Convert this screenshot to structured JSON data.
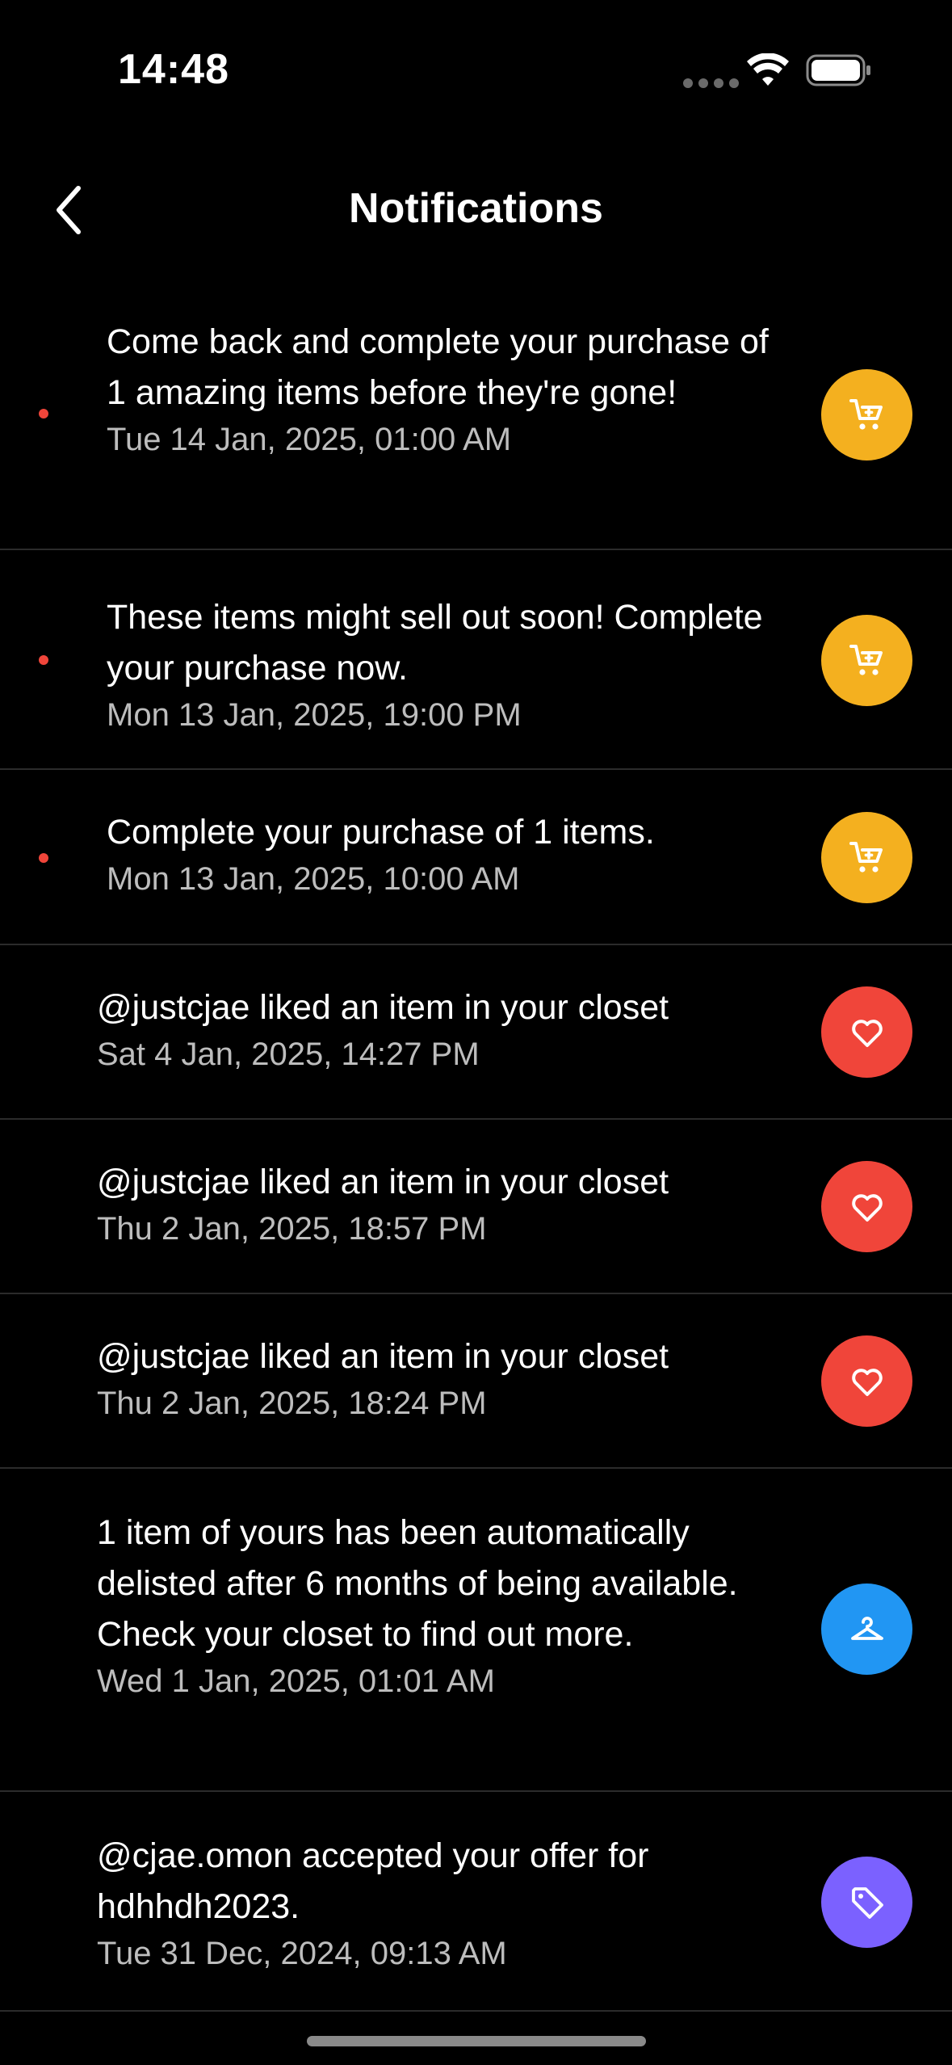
{
  "status_bar": {
    "time": "14:48",
    "icons": [
      "signal-dots-icon",
      "wifi-icon",
      "battery-icon"
    ]
  },
  "header": {
    "title": "Notifications",
    "back_icon": "chevron-left-icon"
  },
  "colors": {
    "background": "#000000",
    "unread_dot": "#f0453a",
    "cart_badge": "#f4b01f",
    "heart_badge": "#f0453a",
    "hanger_badge": "#2196f3",
    "tag_badge": "#7b61ff",
    "divider": "#2b2b2b",
    "secondary_text": "#bdbdbd"
  },
  "notifications": [
    {
      "message": "Come back and complete your purchase of 1 amazing items before they're gone!",
      "time": "Tue 14 Jan, 2025, 01:00 AM",
      "unread": true,
      "icon": "cart-icon"
    },
    {
      "message": "These items might sell out soon! Complete your purchase now.",
      "time": "Mon 13 Jan, 2025, 19:00 PM",
      "unread": true,
      "icon": "cart-icon"
    },
    {
      "message": "Complete your purchase of 1 items.",
      "time": "Mon 13 Jan, 2025, 10:00 AM",
      "unread": true,
      "icon": "cart-icon"
    },
    {
      "message": "@justcjae liked an item in your closet",
      "time": "Sat 4 Jan, 2025, 14:27 PM",
      "unread": false,
      "icon": "heart-icon"
    },
    {
      "message": "@justcjae liked an item in your closet",
      "time": "Thu 2 Jan, 2025, 18:57 PM",
      "unread": false,
      "icon": "heart-icon"
    },
    {
      "message": "@justcjae liked an item in your closet",
      "time": "Thu 2 Jan, 2025, 18:24 PM",
      "unread": false,
      "icon": "heart-icon"
    },
    {
      "message": "1 item of yours has been automatically delisted after 6 months of being available. Check your closet to find out more.",
      "time": "Wed 1 Jan, 2025, 01:01 AM",
      "unread": false,
      "icon": "hanger-icon"
    },
    {
      "message": "@cjae.omon accepted your offer for hdhhdh2023.",
      "time": "Tue 31 Dec, 2024, 09:13 AM",
      "unread": false,
      "icon": "tag-icon"
    }
  ]
}
